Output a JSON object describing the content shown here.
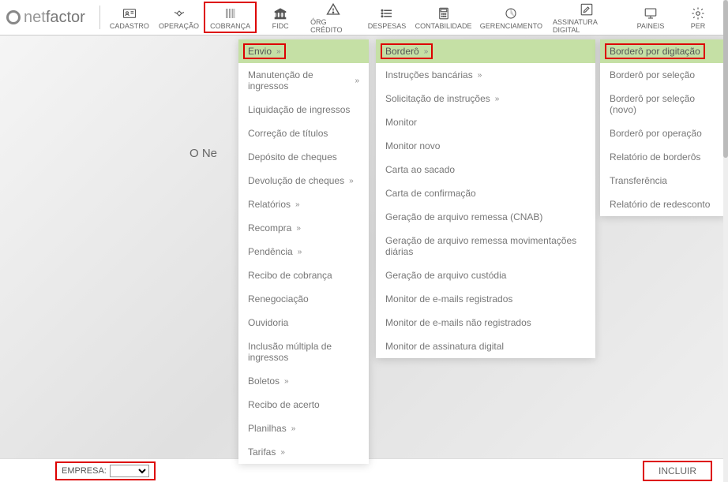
{
  "logo": {
    "part1": "net",
    "part2": "factor"
  },
  "nav": [
    {
      "label": "CADASTRO",
      "icon": "id-card"
    },
    {
      "label": "OPERAÇÃO",
      "icon": "handshake"
    },
    {
      "label": "COBRANÇA",
      "icon": "barcode",
      "highlighted": true
    },
    {
      "label": "FIDC",
      "icon": "bank"
    },
    {
      "label": "ÓRG CRÉDITO",
      "icon": "warning"
    },
    {
      "label": "DESPESAS",
      "icon": "list"
    },
    {
      "label": "CONTABILIDADE",
      "icon": "calculator"
    },
    {
      "label": "GERENCIAMENTO",
      "icon": "pie"
    },
    {
      "label": "ASSINATURA DIGITAL",
      "icon": "edit"
    },
    {
      "label": "PAINEIS",
      "icon": "monitor"
    },
    {
      "label": "PER",
      "icon": "gear"
    }
  ],
  "menu_cols": [
    {
      "header": "Envio",
      "header_chevron": true,
      "header_highlighted": true,
      "items": [
        {
          "label": "Manutenção de ingressos",
          "chevron": true
        },
        {
          "label": "Liquidação de ingressos"
        },
        {
          "label": "Correção de títulos"
        },
        {
          "label": "Depósito de cheques"
        },
        {
          "label": "Devolução de cheques",
          "chevron": true
        },
        {
          "label": "Relatórios",
          "chevron": true
        },
        {
          "label": "Recompra",
          "chevron": true
        },
        {
          "label": "Pendência",
          "chevron": true
        },
        {
          "label": "Recibo de cobrança"
        },
        {
          "label": "Renegociação"
        },
        {
          "label": "Ouvidoria"
        },
        {
          "label": "Inclusão múltipla de ingressos"
        },
        {
          "label": "Boletos",
          "chevron": true
        },
        {
          "label": "Recibo de acerto"
        },
        {
          "label": "Planilhas",
          "chevron": true
        },
        {
          "label": "Tarifas",
          "chevron": true
        }
      ]
    },
    {
      "header": "Borderô",
      "header_chevron": true,
      "header_highlighted": true,
      "items": [
        {
          "label": "Instruções bancárias",
          "chevron": true
        },
        {
          "label": "Solicitação de instruções",
          "chevron": true
        },
        {
          "label": "Monitor"
        },
        {
          "label": "Monitor novo"
        },
        {
          "label": "Carta ao sacado"
        },
        {
          "label": "Carta de confirmação"
        },
        {
          "label": "Geração de arquivo remessa (CNAB)"
        },
        {
          "label": "Geração de arquivo remessa movimentações diárias"
        },
        {
          "label": "Geração de arquivo custódia"
        },
        {
          "label": "Monitor de e-mails registrados"
        },
        {
          "label": "Monitor de e-mails não registrados"
        },
        {
          "label": "Monitor de assinatura digital"
        }
      ]
    },
    {
      "header": "Borderô por digitação",
      "header_chevron": false,
      "header_highlighted": true,
      "items": [
        {
          "label": "Borderô por seleção"
        },
        {
          "label": "Borderô por seleção (novo)"
        },
        {
          "label": "Borderô por operação"
        },
        {
          "label": "Relatório de borderôs"
        },
        {
          "label": "Transferência"
        },
        {
          "label": "Relatório de redesconto"
        }
      ]
    }
  ],
  "bg_text": "O Ne",
  "bottom": {
    "empresa_label": "EMPRESA:",
    "incluir_label": "INCLUIR"
  },
  "icons": {
    "id-card": "▭",
    "handshake": "🤝",
    "barcode": "▮▮▮",
    "bank": "🏛",
    "warning": "⚠",
    "list": "☰",
    "calculator": "▦",
    "pie": "◔",
    "edit": "✎",
    "monitor": "🖵",
    "gear": "⚙"
  }
}
